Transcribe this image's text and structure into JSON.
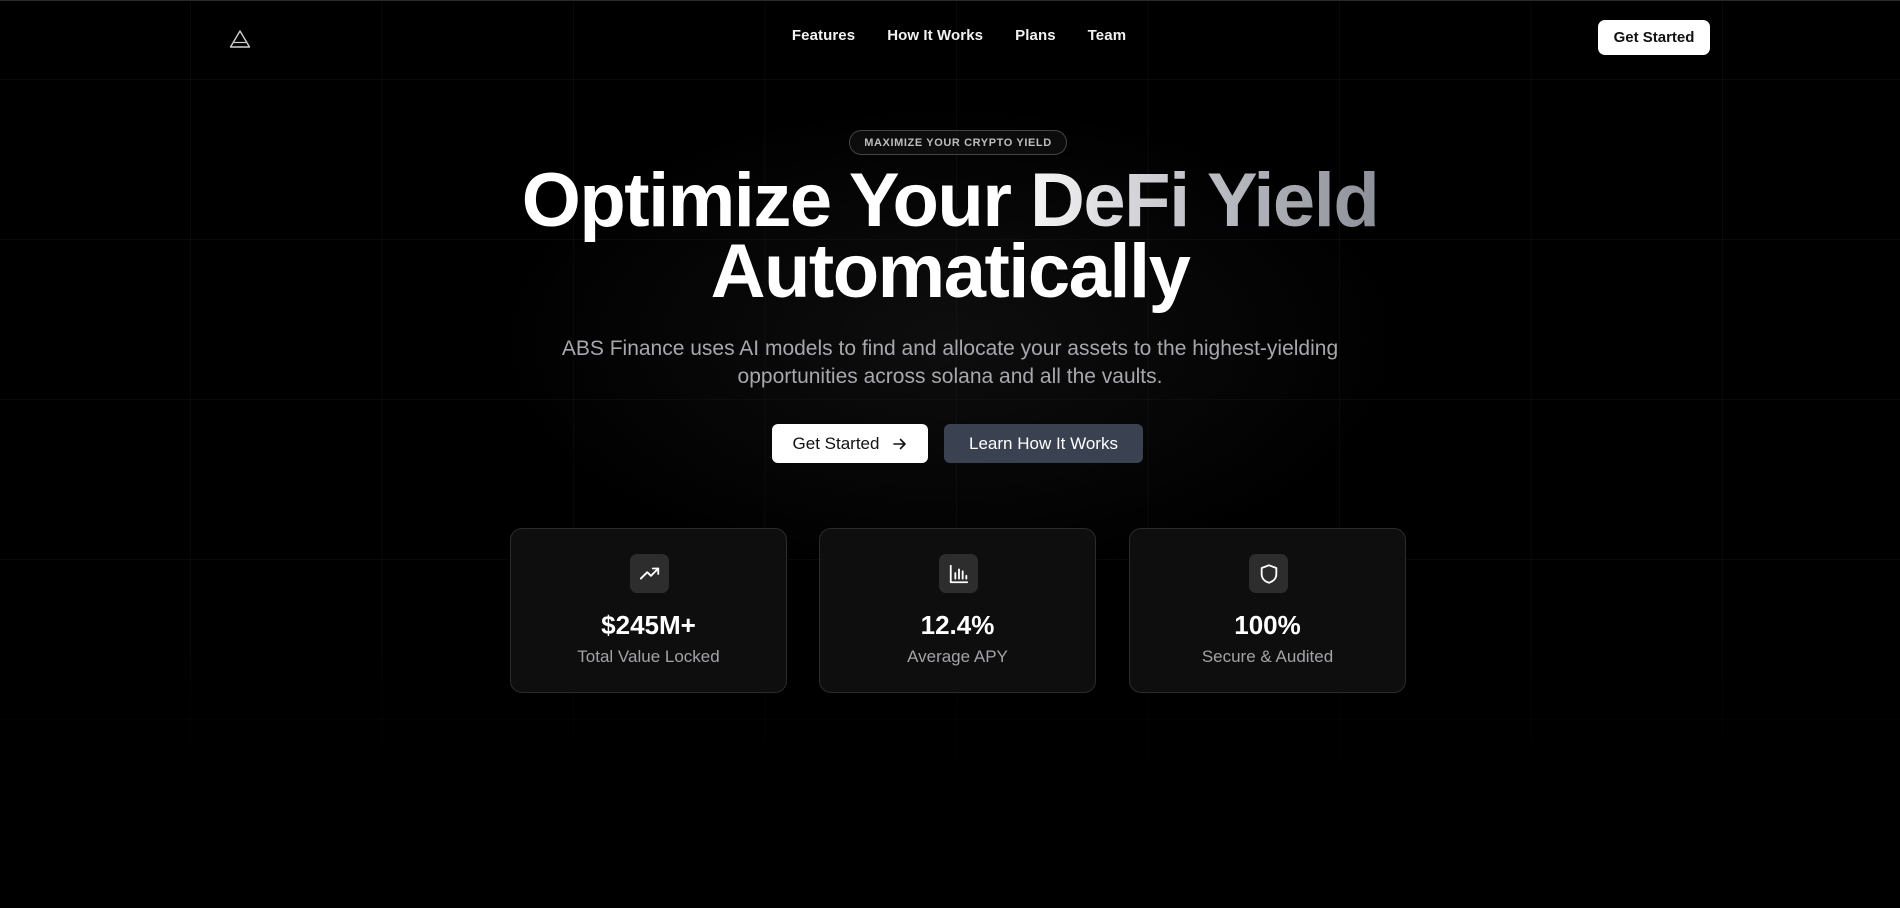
{
  "nav": {
    "logo": "triangle-logo-icon",
    "links": [
      "Features",
      "How It Works",
      "Plans",
      "Team"
    ],
    "cta_label": "Get Started"
  },
  "hero": {
    "badge": "MAXIMIZE YOUR CRYPTO YIELD",
    "headline_line1_part1": "Optimize Your ",
    "headline_line1_part2": "DeFi Yield",
    "headline_line2": "Automatically",
    "subtitle": "ABS Finance uses AI models to find and allocate your assets to the highest-yielding opportunities across solana and all the vaults.",
    "primary_button": "Get Started",
    "primary_button_icon": "arrow-right-icon",
    "secondary_button": "Learn How It Works"
  },
  "stats": [
    {
      "icon": "trending-up-icon",
      "value": "$245M+",
      "label": "Total Value Locked"
    },
    {
      "icon": "bar-chart-icon",
      "value": "12.4%",
      "label": "Average APY"
    },
    {
      "icon": "shield-icon",
      "value": "100%",
      "label": "Secure & Audited"
    }
  ],
  "colors": {
    "background": "#000000",
    "card_background": "#0e0e0e",
    "secondary_button": "#3a4150",
    "muted_text": "#a7a7ad"
  }
}
